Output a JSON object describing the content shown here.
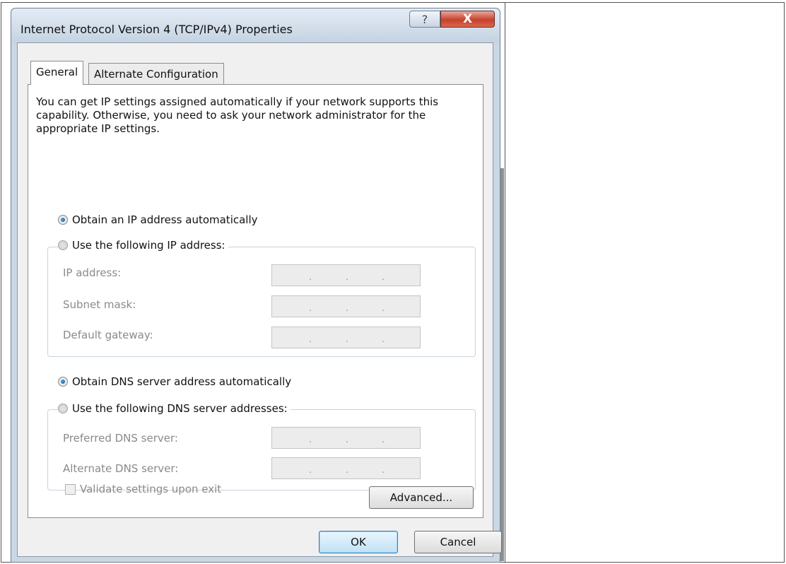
{
  "dialog": {
    "title": "Internet Protocol Version 4 (TCP/IPv4) Properties",
    "help_glyph": "?",
    "close_glyph": "X"
  },
  "tabs": [
    {
      "label": "General",
      "selected": true
    },
    {
      "label": "Alternate Configuration",
      "selected": false
    }
  ],
  "intro_text": "You can get IP settings assigned automatically if your network supports this capability. Otherwise, you need to ask your network administrator for the appropriate IP settings.",
  "ip_section": {
    "auto_option": {
      "label": "Obtain an IP address automatically",
      "checked": true
    },
    "manual_option": {
      "label": "Use the following IP address:",
      "checked": false
    },
    "fields": [
      {
        "label": "IP address:",
        "value": ". . ."
      },
      {
        "label": "Subnet mask:",
        "value": ". . ."
      },
      {
        "label": "Default gateway:",
        "value": ". . ."
      }
    ]
  },
  "dns_section": {
    "auto_option": {
      "label": "Obtain DNS server address automatically",
      "checked": true
    },
    "manual_option": {
      "label": "Use the following DNS server addresses:",
      "checked": false
    },
    "fields": [
      {
        "label": "Preferred DNS server:",
        "value": ". . ."
      },
      {
        "label": "Alternate DNS server:",
        "value": ". . ."
      }
    ]
  },
  "validate_checkbox": {
    "label": "Validate settings upon exit",
    "checked": false,
    "enabled": false
  },
  "buttons": {
    "advanced": "Advanced...",
    "ok": "OK",
    "cancel": "Cancel"
  },
  "colors": {
    "titlebar": "#c5d3e2",
    "close_button": "#c7412c",
    "ok_default_border": "#3c7fb1",
    "disabled_text": "#8a8a8a"
  }
}
